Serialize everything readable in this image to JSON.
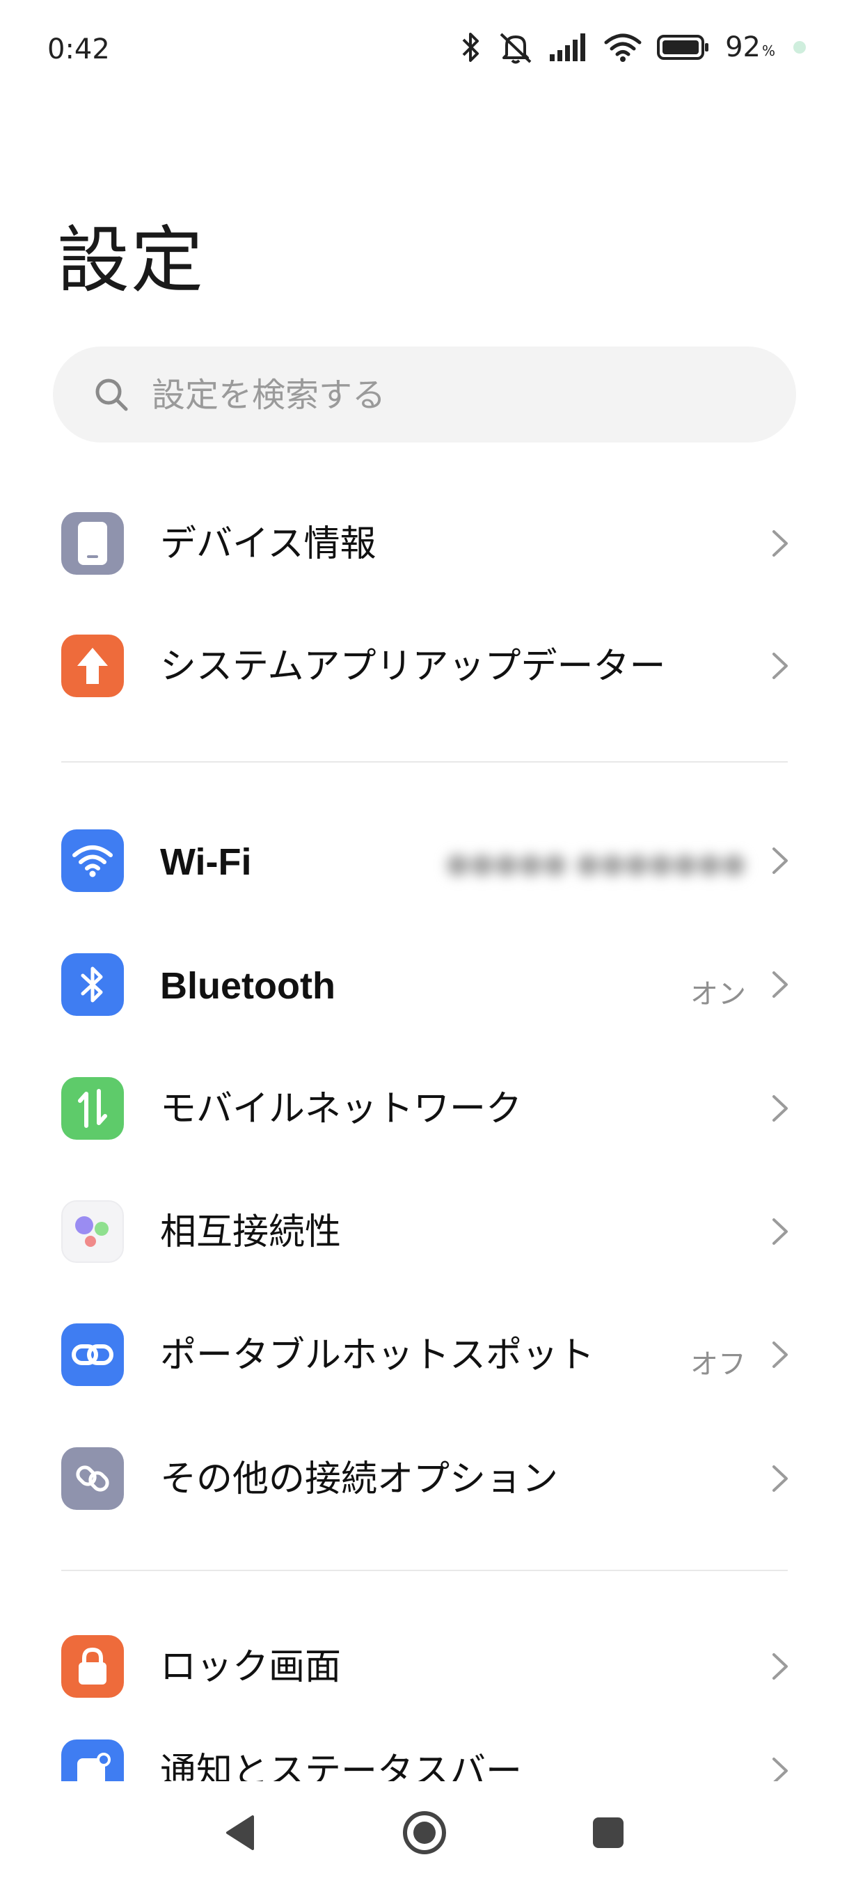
{
  "status": {
    "time": "0:42",
    "battery_percent": "92",
    "battery_unit": "%",
    "icons": [
      "bluetooth-icon",
      "mute-icon",
      "signal-icon",
      "wifi-icon",
      "battery-icon"
    ]
  },
  "title": "設定",
  "search": {
    "placeholder": "設定を検索する"
  },
  "sections": [
    {
      "items": [
        {
          "label": "デバイス情報",
          "icon": "phone-icon",
          "icon_color": "#8f93ad"
        },
        {
          "label": "システムアプリアップデーター",
          "icon": "arrow-up-icon",
          "icon_color": "#ee6b3b"
        }
      ]
    },
    {
      "items": [
        {
          "label": "Wi-Fi",
          "icon": "wifi-icon",
          "icon_color": "#3f7df2",
          "value": "●●●●● ●●●●●●●",
          "value_blurred": true
        },
        {
          "label": "Bluetooth",
          "icon": "bluetooth-icon",
          "icon_color": "#3f7df2",
          "value": "オン"
        },
        {
          "label": "モバイルネットワーク",
          "icon": "mobile-data-icon",
          "icon_color": "#5ecb6a"
        },
        {
          "label": "相互接続性",
          "icon": "interconnect-icon",
          "icon_color": "#f4f4f6"
        },
        {
          "label": "ポータブルホットスポット",
          "icon": "link-icon",
          "icon_color": "#3f7df2",
          "value": "オフ"
        },
        {
          "label": "その他の接続オプション",
          "icon": "connection-options-icon",
          "icon_color": "#8f93ad"
        }
      ]
    },
    {
      "items": [
        {
          "label": "ロック画面",
          "icon": "lock-icon",
          "icon_color": "#ee6b3b"
        },
        {
          "label": "通知とステータスバー",
          "icon": "notification-icon",
          "icon_color": "#3f7df2"
        }
      ]
    }
  ],
  "nav": {
    "buttons": [
      "back-icon",
      "home-icon",
      "recents-icon"
    ]
  }
}
